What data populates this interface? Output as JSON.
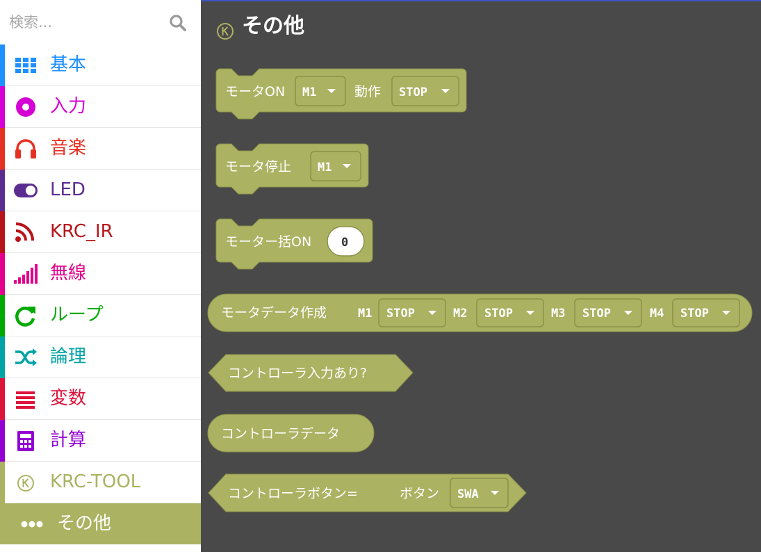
{
  "colors": {
    "toolbox_bg": "#ffffff",
    "workspace_bg": "#4a4949",
    "block": "#abb262",
    "block_border": "#8b9148",
    "accent_line": "#3f55c9"
  },
  "search": {
    "placeholder": "検索...",
    "icon": "search-icon"
  },
  "categories": [
    {
      "label": "基本",
      "color": "#1e90ff",
      "icon": "grid-icon"
    },
    {
      "label": "入力",
      "color": "#d400d4",
      "icon": "circle-dot-icon"
    },
    {
      "label": "音楽",
      "color": "#e63022",
      "icon": "headphones-icon"
    },
    {
      "label": "LED",
      "color": "#5c2d91",
      "icon": "toggle-icon"
    },
    {
      "label": "KRC_IR",
      "color": "#b7141a",
      "icon": "rss-icon"
    },
    {
      "label": "無線",
      "color": "#e3008c",
      "icon": "signal-bars-icon"
    },
    {
      "label": "ループ",
      "color": "#00aa00",
      "icon": "refresh-icon"
    },
    {
      "label": "論理",
      "color": "#00a4a6",
      "icon": "shuffle-icon"
    },
    {
      "label": "変数",
      "color": "#dc143c",
      "icon": "list-icon"
    },
    {
      "label": "計算",
      "color": "#9400d3",
      "icon": "calculator-icon"
    },
    {
      "label": "KRC-TOOL",
      "color": "#abb262",
      "icon": "k-circle-icon"
    },
    {
      "label": "その他",
      "color": "#abb262",
      "icon": "more-dots-icon",
      "selected": true
    }
  ],
  "flyout": {
    "title": "その他",
    "icon": "k-circle-icon",
    "blocks": {
      "motor_on": {
        "text1": "モータON",
        "dd1": "M1",
        "text2": "動作",
        "dd2": "STOP"
      },
      "motor_stop": {
        "text1": "モータ停止",
        "dd1": "M1"
      },
      "motor_all_on": {
        "text1": "モーター括ON",
        "value": "0"
      },
      "motor_data": {
        "text1": "モータデータ作成",
        "pairs": [
          {
            "label": "M1",
            "value": "STOP"
          },
          {
            "label": "M2",
            "value": "STOP"
          },
          {
            "label": "M3",
            "value": "STOP"
          },
          {
            "label": "M4",
            "value": "STOP"
          }
        ]
      },
      "controller_input": {
        "text1": "コントローラ入力あり?"
      },
      "controller_data": {
        "text1": "コントローラデータ"
      },
      "controller_button": {
        "text1": "コントローラボタン=",
        "text2": "ボタン",
        "dd1": "SWA"
      }
    }
  }
}
